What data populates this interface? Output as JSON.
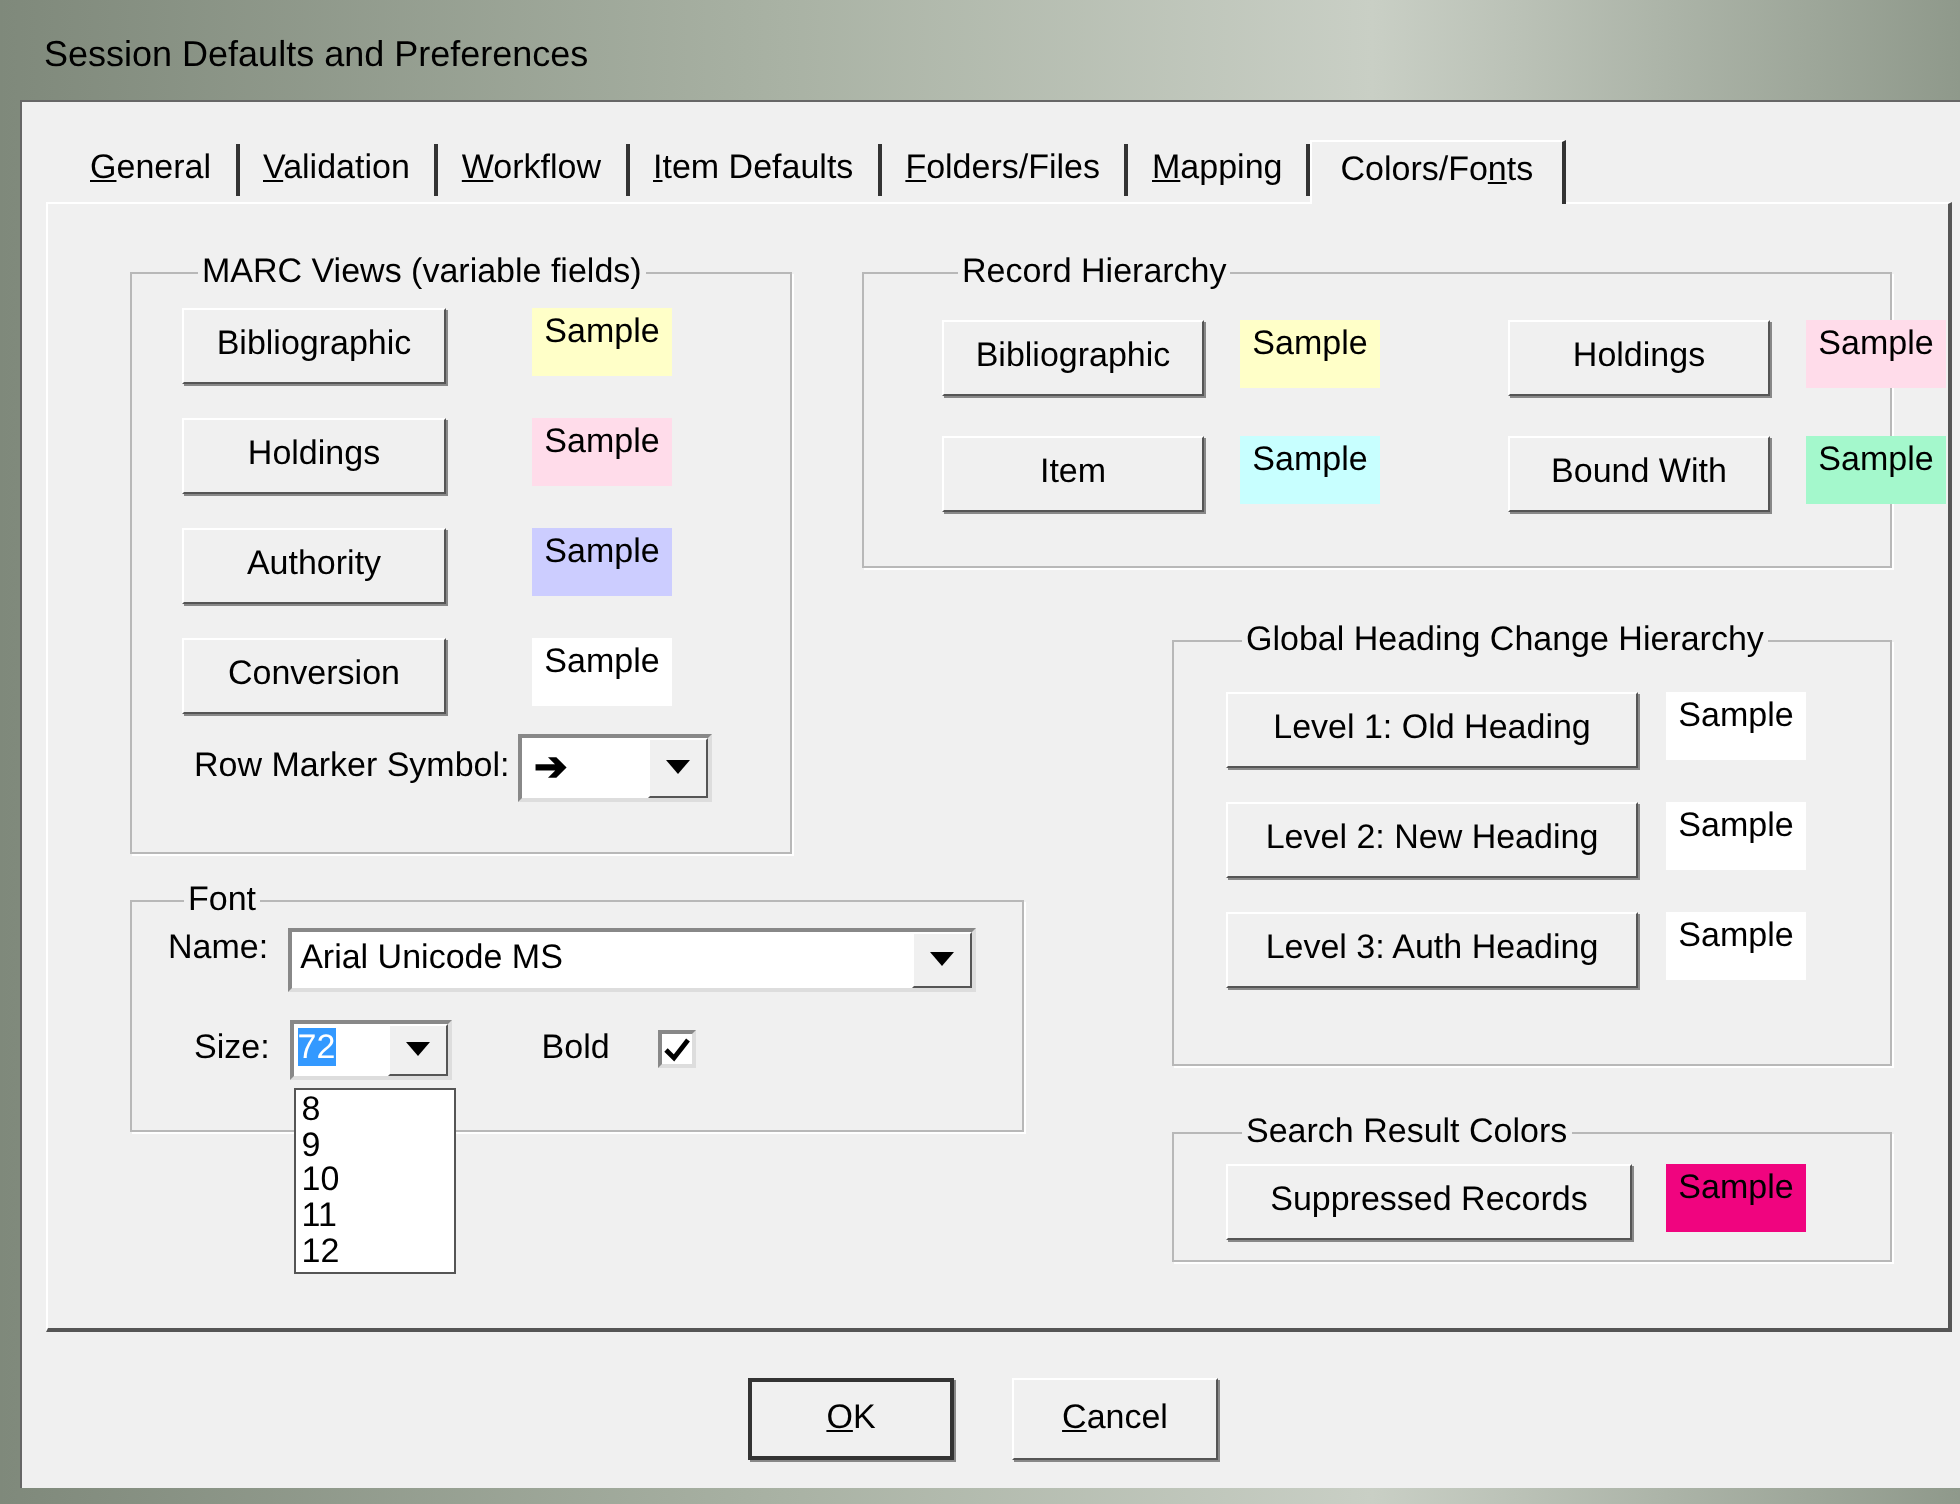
{
  "window": {
    "title": "Session Defaults and Preferences"
  },
  "tabs": [
    {
      "key": "G",
      "post": "eneral",
      "selected": false
    },
    {
      "key": "V",
      "post": "alidation",
      "selected": false
    },
    {
      "key": "W",
      "post": "orkflow",
      "selected": false
    },
    {
      "key": "I",
      "post": "tem Defaults",
      "selected": false
    },
    {
      "key": "F",
      "post": "olders/Files",
      "selected": false
    },
    {
      "key": "M",
      "post": "apping",
      "selected": false
    },
    {
      "pre": "Colors/Fo",
      "key": "n",
      "post": "ts",
      "selected": true
    }
  ],
  "marc_views": {
    "title": "MARC Views (variable fields)",
    "rows": [
      {
        "button": "Bibliographic",
        "sample": "Sample",
        "color": "#ffffc8"
      },
      {
        "button": "Holdings",
        "sample": "Sample",
        "color": "#ffdcea"
      },
      {
        "button": "Authority",
        "sample": "Sample",
        "color": "#cccdff"
      },
      {
        "button": "Conversion",
        "sample": "Sample",
        "color": "#ffffff"
      }
    ],
    "row_marker": {
      "label": "Row Marker Symbol:",
      "value": "➔"
    }
  },
  "record_hierarchy": {
    "title": "Record Hierarchy",
    "items": [
      {
        "button": "Bibliographic",
        "sample": "Sample",
        "color": "#ffffc8"
      },
      {
        "button": "Holdings",
        "sample": "Sample",
        "color": "#ffdcea"
      },
      {
        "button": "Item",
        "sample": "Sample",
        "color": "#c8ffff"
      },
      {
        "button": "Bound With",
        "sample": "Sample",
        "color": "#a4f8cc"
      }
    ]
  },
  "font": {
    "title": "Font",
    "name_label": "Name:",
    "name_value": "Arial Unicode MS",
    "size_label": "Size:",
    "size_value": "72",
    "size_text_selected": true,
    "bold_label": "Bold",
    "bold_checked": true,
    "size_list_open": true,
    "size_options": [
      "8",
      "9",
      "10",
      "11",
      "12"
    ]
  },
  "global_heading": {
    "title": "Global Heading Change Hierarchy",
    "items": [
      {
        "button": "Level 1: Old Heading",
        "sample": "Sample",
        "color": "#ffffff"
      },
      {
        "button": "Level 2: New Heading",
        "sample": "Sample",
        "color": "#ffffff"
      },
      {
        "button": "Level 3: Auth Heading",
        "sample": "Sample",
        "color": "#ffffff"
      }
    ]
  },
  "search_results": {
    "title": "Search Result Colors",
    "items": [
      {
        "button": "Suppressed Records",
        "sample": "Sample",
        "color": "#f0047f"
      }
    ]
  },
  "buttons": [
    {
      "key": "O",
      "post": "K",
      "default": true
    },
    {
      "key": "C",
      "post": "ancel",
      "default": false
    }
  ]
}
